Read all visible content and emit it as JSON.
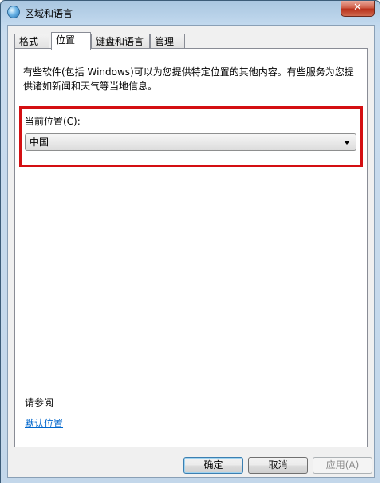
{
  "window": {
    "title": "区域和语言",
    "close_label": "✕"
  },
  "tabs": [
    {
      "label": "格式"
    },
    {
      "label": "位置"
    },
    {
      "label": "键盘和语言"
    },
    {
      "label": "管理"
    }
  ],
  "location_panel": {
    "description": "有些软件(包括 Windows)可以为您提供特定位置的其他内容。有些服务为您提供诸如新闻和天气等当地信息。",
    "current_location_label": "当前位置(C):",
    "current_location_value": "中国",
    "see_also_label": "请参阅",
    "default_location_link": "默认位置"
  },
  "buttons": {
    "ok": "确定",
    "cancel": "取消",
    "apply": "应用(A)"
  },
  "colors": {
    "highlight_border": "#d40f12",
    "link": "#0066cc"
  },
  "icons": {
    "title_icon": "globe-icon",
    "dropdown": "chevron-down-icon"
  }
}
